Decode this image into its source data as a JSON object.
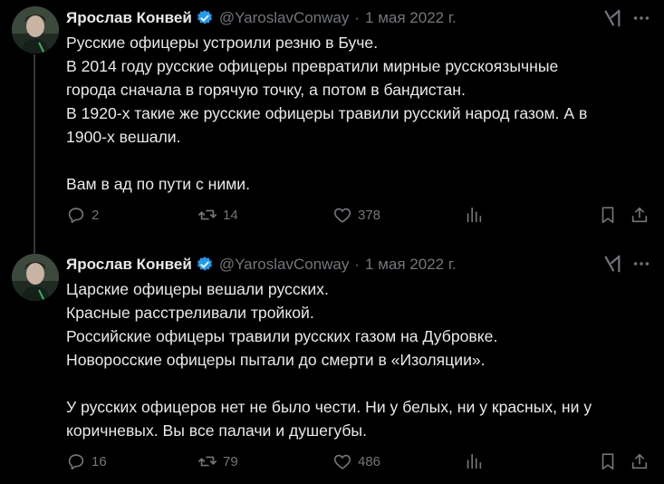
{
  "tweets": [
    {
      "author": "Ярослав Конвей",
      "handle": "@YaroslavConway",
      "separator": "·",
      "date": "1 мая 2022 г.",
      "lines": [
        "Русские офицеры устроили резню в Буче.",
        "В 2014 году русские офицеры превратили мирные русскоязычные",
        "города сначала в горячую точку, а потом в бандистан.",
        "В 1920-х такие же русские офицеры травили русский народ газом. А в",
        "1900-х вешали.",
        "",
        "Вам в ад по пути с ними."
      ],
      "replies": "2",
      "reposts": "14",
      "likes": "378"
    },
    {
      "author": "Ярослав Конвей",
      "handle": "@YaroslavConway",
      "separator": "·",
      "date": "1 мая 2022 г.",
      "lines": [
        "Царские офицеры вешали русских.",
        "Красные  расстреливали тройкой.",
        "Российские офицеры травили русских газом на Дубровке.",
        "Новоросские офицеры пытали до смерти в «Изоляции».",
        "",
        "У русских офицеров нет не было чести. Ни у белых, ни у красных, ни у",
        "коричневых. Вы все палачи и душегубы."
      ],
      "replies": "16",
      "reposts": "79",
      "likes": "486"
    }
  ],
  "icons": {
    "verified": "verified-badge-icon",
    "grok": "grok-icon",
    "more": "more-icon",
    "reply": "reply-icon",
    "repost": "repost-icon",
    "like": "like-icon",
    "views": "views-icon",
    "bookmark": "bookmark-icon",
    "share": "share-icon"
  },
  "colors": {
    "background": "#000000",
    "text": "#e7e9ea",
    "secondary": "#71767b",
    "verified": "#1d9bf0"
  }
}
